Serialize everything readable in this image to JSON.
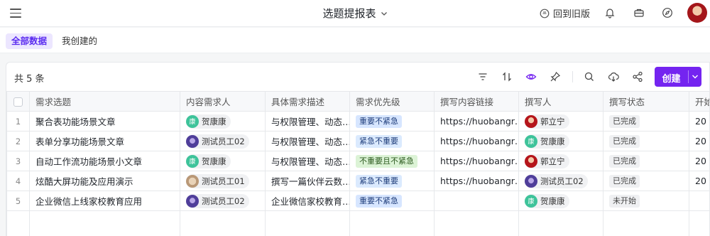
{
  "header": {
    "title": "选题提报表",
    "back_old": "回到旧版"
  },
  "tabs": [
    {
      "label": "全部数据",
      "active": true
    },
    {
      "label": "我创建的",
      "active": false
    }
  ],
  "toolbar": {
    "count": "共 5 条",
    "create_label": "创建"
  },
  "table": {
    "columns": [
      "需求选题",
      "内容需求人",
      "具体需求描述",
      "需求优先级",
      "撰写内容链接",
      "撰写人",
      "撰写状态",
      "开始"
    ],
    "rows": [
      {
        "index": "1",
        "topic": "聚合表功能场景文章",
        "requester": {
          "name": "贺康康",
          "avatar_text": "康",
          "avatar": "green"
        },
        "description": "与权限管理、动态…",
        "priority": {
          "label": "重要不紧急",
          "color": "#d7e6ff",
          "text_color": "#1f3d7a"
        },
        "link": "https://huobangr…",
        "writer": {
          "name": "郭立宁",
          "avatar_text": "",
          "avatar": "red"
        },
        "status": "已完成",
        "start": "20"
      },
      {
        "index": "2",
        "topic": "表单分享功能场景文章",
        "requester": {
          "name": "测试员工02",
          "avatar_text": "",
          "avatar": "purple"
        },
        "description": "与权限管理、动态…",
        "priority": {
          "label": "紧急不重要",
          "color": "#dbeafe",
          "text_color": "#1f3d7a"
        },
        "link": "https://huobangr…",
        "writer": {
          "name": "贺康康",
          "avatar_text": "康",
          "avatar": "green"
        },
        "status": "已完成",
        "start": "20"
      },
      {
        "index": "3",
        "topic": "自动工作流功能场景小文章",
        "requester": {
          "name": "贺康康",
          "avatar_text": "康",
          "avatar": "green"
        },
        "description": "与权限管理、动态…",
        "priority": {
          "label": "不重要且不紧急",
          "color": "#dcf3d6",
          "text_color": "#2c5a1f"
        },
        "link": "https://huobangr…",
        "writer": {
          "name": "郭立宁",
          "avatar_text": "",
          "avatar": "red"
        },
        "status": "已完成",
        "start": "20"
      },
      {
        "index": "4",
        "topic": "炫酷大屏功能及应用演示",
        "requester": {
          "name": "测试员工01",
          "avatar_text": "",
          "avatar": "dog"
        },
        "description": "撰写一篇伙伴云数…",
        "priority": {
          "label": "紧急不重要",
          "color": "#dbeafe",
          "text_color": "#1f3d7a"
        },
        "link": "https://huobangr…",
        "writer": {
          "name": "测试员工02",
          "avatar_text": "",
          "avatar": "purple"
        },
        "status": "已完成",
        "start": "20"
      },
      {
        "index": "5",
        "topic": "企业微信上线家校教育应用",
        "requester": {
          "name": "测试员工02",
          "avatar_text": "",
          "avatar": "purple"
        },
        "description": "企业微信家校教育…",
        "priority": {
          "label": "重要不紧急",
          "color": "#d7e6ff",
          "text_color": "#1f3d7a"
        },
        "link": "",
        "writer": {
          "name": "贺康康",
          "avatar_text": "康",
          "avatar": "green"
        },
        "status": "未开始",
        "start": ""
      }
    ]
  },
  "colors": {
    "accent": "#7424f0",
    "tab_active_bg": "#ece6ff",
    "tab_active_text": "#5b2cf0"
  },
  "icons": [
    "menu-icon",
    "chevron-down-icon",
    "history-icon",
    "bell-icon",
    "toolbox-icon",
    "compass-icon",
    "filter-icon",
    "sort-icon",
    "eye-icon",
    "pin-icon",
    "search-icon",
    "cloud-download-icon",
    "share-icon"
  ]
}
